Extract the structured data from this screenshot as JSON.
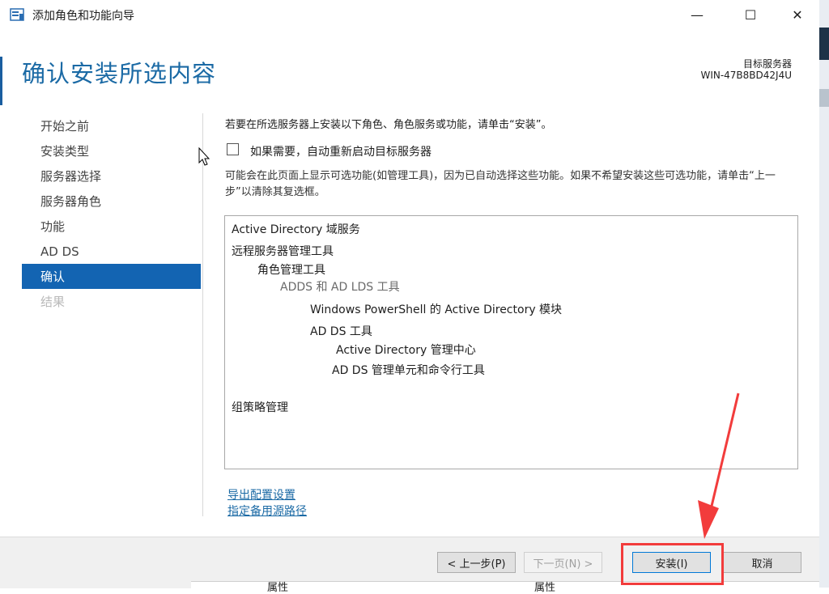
{
  "window": {
    "title": "添加角色和功能向导",
    "min_glyph": "—",
    "max_glyph": "☐",
    "close_glyph": "✕"
  },
  "header": {
    "page_title": "确认安装所选内容",
    "server_label": "目标服务器",
    "server_name": "WIN-47B8BD42J4U"
  },
  "nav": {
    "items": [
      {
        "label": "开始之前",
        "state": "normal"
      },
      {
        "label": "安装类型",
        "state": "normal"
      },
      {
        "label": "服务器选择",
        "state": "normal"
      },
      {
        "label": "服务器角色",
        "state": "normal"
      },
      {
        "label": "功能",
        "state": "normal"
      },
      {
        "label": "AD DS",
        "state": "normal"
      },
      {
        "label": "确认",
        "state": "selected"
      },
      {
        "label": "结果",
        "state": "disabled"
      }
    ]
  },
  "content": {
    "instruction": "若要在所选服务器上安装以下角色、角色服务或功能，请单击“安装”。",
    "restart_label": "如果需要，自动重新启动目标服务器",
    "restart_checked": false,
    "note": "可能会在此页面上显示可选功能(如管理工具)，因为已自动选择这些功能。如果不希望安装这些可选功能，请单击“上一步”以清除其复选框。",
    "features": [
      "Active Directory 域服务",
      "远程服务器管理工具",
      "角色管理工具",
      "ADDS 和 AD LDS 工具",
      "Windows PowerShell 的 Active Directory 模块",
      "AD DS 工具",
      "Active Directory 管理中心",
      "AD DS 管理单元和命令行工具",
      "组策略管理"
    ],
    "export_link": "导出配置设置",
    "source_link": "指定备用源路径"
  },
  "footer": {
    "prev_label": "< 上一步(P)",
    "next_label": "下一页(N) >",
    "install_label": "安装(I)",
    "cancel_label": "取消"
  },
  "background": {
    "cut_text_1": "属性",
    "cut_text_2": "属性"
  },
  "colors": {
    "accent": "#1b6aa5",
    "nav_selected": "#1364b2",
    "annotation": "#f23c3c"
  }
}
